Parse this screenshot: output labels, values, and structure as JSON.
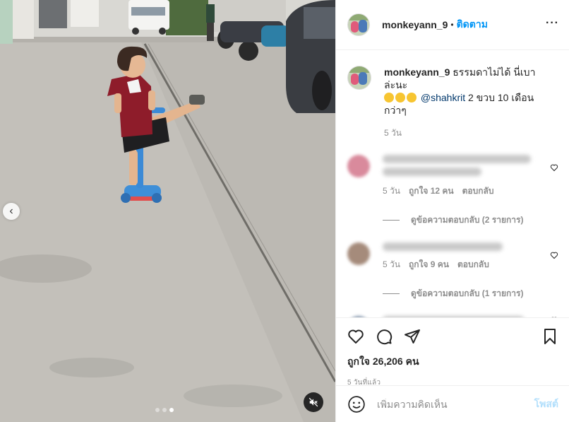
{
  "header": {
    "username": "monkeyann_9",
    "bullet": "•",
    "follow_label": "ติดตาม",
    "more_label": "···"
  },
  "caption": {
    "username": "monkeyann_9",
    "text": "ธรรมดาไม่ได้ นี่เบาล่ะนะ",
    "emojis": [
      "grinning-sweat",
      "grinning-sweat",
      "grinning-sweat"
    ],
    "mention": "@shahkrit",
    "text_after": "2 ขวบ 10 เดือนกว่าๆ",
    "time": "5 วัน"
  },
  "comments": [
    {
      "time": "5 วัน",
      "likes": "ถูกใจ 12 คน",
      "reply_label": "ตอบกลับ",
      "view_replies": "ดูข้อความตอบกลับ (2 รายการ)",
      "avatar_color": "#d98a9c"
    },
    {
      "time": "5 วัน",
      "likes": "ถูกใจ 9 คน",
      "reply_label": "ตอบกลับ",
      "view_replies": "ดูข้อความตอบกลับ (1 รายการ)",
      "avatar_color": "#a58b7b"
    }
  ],
  "actions": {
    "likes_count": "ถูกใจ 26,206 คน",
    "posted_ago": "5 วันที่แล้ว",
    "icons": [
      "heart-icon",
      "comment-icon",
      "share-icon",
      "bookmark-icon"
    ]
  },
  "add_comment": {
    "placeholder": "เพิ่มความคิดเห็น",
    "post_label": "โพสต์"
  },
  "media": {
    "carousel_total": 3,
    "carousel_active": 3
  },
  "colors": {
    "accent": "#0095f6",
    "post_button_disabled": "#b2dffc",
    "mention": "#00376b",
    "meta": "#8e8e8e"
  }
}
